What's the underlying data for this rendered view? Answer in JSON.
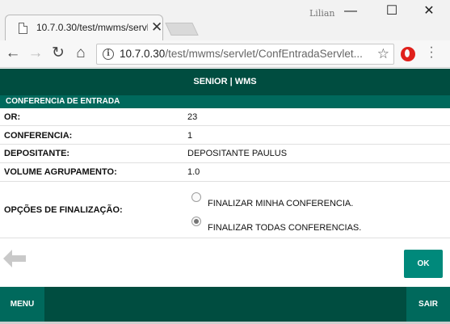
{
  "browser": {
    "profile_name": "Lilian",
    "tab_title": "10.7.0.30/test/mwms/servlet/ConfEntradaServlet",
    "url_host": "10.7.0.30",
    "url_path": "/test/mwms/servlet/ConfEntradaServlet...",
    "window_controls": {
      "minimize": "—",
      "maximize": "☐",
      "close": "✕"
    }
  },
  "app": {
    "header": "SENIOR | WMS",
    "section_title": "CONFERENCIA DE ENTRADA",
    "fields": [
      {
        "label": "OR:",
        "value": "23"
      },
      {
        "label": "CONFERENCIA:",
        "value": "1"
      },
      {
        "label": "DEPOSITANTE:",
        "value": "DEPOSITANTE PAULUS"
      },
      {
        "label": "VOLUME AGRUPAMENTO:",
        "value": "1.0"
      }
    ],
    "finalization": {
      "label": "OPÇÕES DE FINALIZAÇÃO:",
      "options": [
        {
          "label": "FINALIZAR MINHA CONFERENCIA.",
          "selected": false
        },
        {
          "label": "FINALIZAR TODAS CONFERENCIAS.",
          "selected": true
        }
      ]
    },
    "ok_label": "OK",
    "menu_label": "MENU",
    "exit_label": "SAIR"
  },
  "colors": {
    "dark_green": "#004d40",
    "green": "#00695c",
    "button_green": "#00897b"
  }
}
